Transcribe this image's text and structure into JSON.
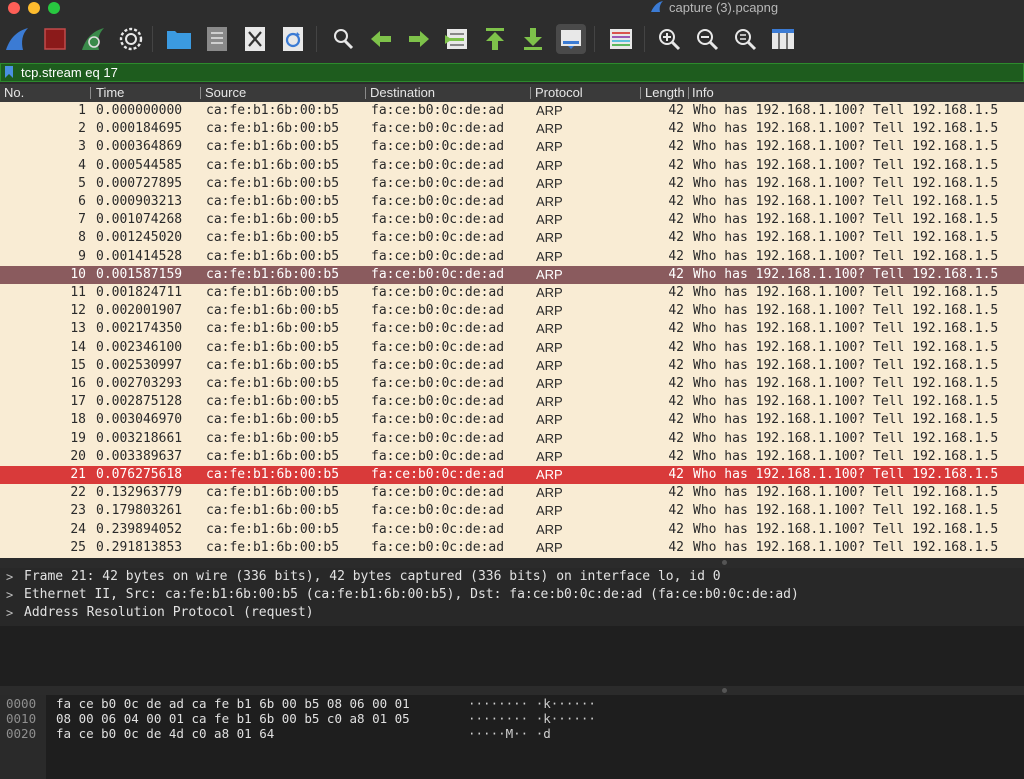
{
  "window": {
    "title": "capture (3).pcapng"
  },
  "toolbar": {
    "buttons": [
      {
        "name": "start-capture-icon"
      },
      {
        "name": "stop-capture-icon"
      },
      {
        "name": "restart-capture-icon"
      },
      {
        "name": "capture-options-icon"
      },
      {
        "name": "open-file-icon"
      },
      {
        "name": "save-file-icon"
      },
      {
        "name": "close-file-icon"
      },
      {
        "name": "reload-file-icon"
      },
      {
        "name": "find-packet-icon"
      },
      {
        "name": "go-back-icon"
      },
      {
        "name": "go-forward-icon"
      },
      {
        "name": "go-to-packet-icon"
      },
      {
        "name": "go-first-packet-icon"
      },
      {
        "name": "go-last-packet-icon"
      },
      {
        "name": "auto-scroll-icon"
      },
      {
        "name": "colorize-icon"
      },
      {
        "name": "zoom-in-icon"
      },
      {
        "name": "zoom-out-icon"
      },
      {
        "name": "zoom-normal-icon"
      },
      {
        "name": "resize-columns-icon"
      }
    ]
  },
  "filter": {
    "value": "tcp.stream eq 17"
  },
  "columns": {
    "no": "No.",
    "time": "Time",
    "source": "Source",
    "destination": "Destination",
    "protocol": "Protocol",
    "length": "Length",
    "info": "Info"
  },
  "packets": [
    {
      "no": "1",
      "time": "0.000000000",
      "source": "ca:fe:b1:6b:00:b5",
      "destination": "fa:ce:b0:0c:de:ad",
      "protocol": "ARP",
      "length": "42",
      "info": "Who has 192.168.1.100? Tell 192.168.1.5"
    },
    {
      "no": "2",
      "time": "0.000184695",
      "source": "ca:fe:b1:6b:00:b5",
      "destination": "fa:ce:b0:0c:de:ad",
      "protocol": "ARP",
      "length": "42",
      "info": "Who has 192.168.1.100? Tell 192.168.1.5"
    },
    {
      "no": "3",
      "time": "0.000364869",
      "source": "ca:fe:b1:6b:00:b5",
      "destination": "fa:ce:b0:0c:de:ad",
      "protocol": "ARP",
      "length": "42",
      "info": "Who has 192.168.1.100? Tell 192.168.1.5"
    },
    {
      "no": "4",
      "time": "0.000544585",
      "source": "ca:fe:b1:6b:00:b5",
      "destination": "fa:ce:b0:0c:de:ad",
      "protocol": "ARP",
      "length": "42",
      "info": "Who has 192.168.1.100? Tell 192.168.1.5"
    },
    {
      "no": "5",
      "time": "0.000727895",
      "source": "ca:fe:b1:6b:00:b5",
      "destination": "fa:ce:b0:0c:de:ad",
      "protocol": "ARP",
      "length": "42",
      "info": "Who has 192.168.1.100? Tell 192.168.1.5"
    },
    {
      "no": "6",
      "time": "0.000903213",
      "source": "ca:fe:b1:6b:00:b5",
      "destination": "fa:ce:b0:0c:de:ad",
      "protocol": "ARP",
      "length": "42",
      "info": "Who has 192.168.1.100? Tell 192.168.1.5"
    },
    {
      "no": "7",
      "time": "0.001074268",
      "source": "ca:fe:b1:6b:00:b5",
      "destination": "fa:ce:b0:0c:de:ad",
      "protocol": "ARP",
      "length": "42",
      "info": "Who has 192.168.1.100? Tell 192.168.1.5"
    },
    {
      "no": "8",
      "time": "0.001245020",
      "source": "ca:fe:b1:6b:00:b5",
      "destination": "fa:ce:b0:0c:de:ad",
      "protocol": "ARP",
      "length": "42",
      "info": "Who has 192.168.1.100? Tell 192.168.1.5"
    },
    {
      "no": "9",
      "time": "0.001414528",
      "source": "ca:fe:b1:6b:00:b5",
      "destination": "fa:ce:b0:0c:de:ad",
      "protocol": "ARP",
      "length": "42",
      "info": "Who has 192.168.1.100? Tell 192.168.1.5"
    },
    {
      "no": "10",
      "time": "0.001587159",
      "source": "ca:fe:b1:6b:00:b5",
      "destination": "fa:ce:b0:0c:de:ad",
      "protocol": "ARP",
      "length": "42",
      "info": "Who has 192.168.1.100? Tell 192.168.1.5"
    },
    {
      "no": "11",
      "time": "0.001824711",
      "source": "ca:fe:b1:6b:00:b5",
      "destination": "fa:ce:b0:0c:de:ad",
      "protocol": "ARP",
      "length": "42",
      "info": "Who has 192.168.1.100? Tell 192.168.1.5"
    },
    {
      "no": "12",
      "time": "0.002001907",
      "source": "ca:fe:b1:6b:00:b5",
      "destination": "fa:ce:b0:0c:de:ad",
      "protocol": "ARP",
      "length": "42",
      "info": "Who has 192.168.1.100? Tell 192.168.1.5"
    },
    {
      "no": "13",
      "time": "0.002174350",
      "source": "ca:fe:b1:6b:00:b5",
      "destination": "fa:ce:b0:0c:de:ad",
      "protocol": "ARP",
      "length": "42",
      "info": "Who has 192.168.1.100? Tell 192.168.1.5"
    },
    {
      "no": "14",
      "time": "0.002346100",
      "source": "ca:fe:b1:6b:00:b5",
      "destination": "fa:ce:b0:0c:de:ad",
      "protocol": "ARP",
      "length": "42",
      "info": "Who has 192.168.1.100? Tell 192.168.1.5"
    },
    {
      "no": "15",
      "time": "0.002530997",
      "source": "ca:fe:b1:6b:00:b5",
      "destination": "fa:ce:b0:0c:de:ad",
      "protocol": "ARP",
      "length": "42",
      "info": "Who has 192.168.1.100? Tell 192.168.1.5"
    },
    {
      "no": "16",
      "time": "0.002703293",
      "source": "ca:fe:b1:6b:00:b5",
      "destination": "fa:ce:b0:0c:de:ad",
      "protocol": "ARP",
      "length": "42",
      "info": "Who has 192.168.1.100? Tell 192.168.1.5"
    },
    {
      "no": "17",
      "time": "0.002875128",
      "source": "ca:fe:b1:6b:00:b5",
      "destination": "fa:ce:b0:0c:de:ad",
      "protocol": "ARP",
      "length": "42",
      "info": "Who has 192.168.1.100? Tell 192.168.1.5"
    },
    {
      "no": "18",
      "time": "0.003046970",
      "source": "ca:fe:b1:6b:00:b5",
      "destination": "fa:ce:b0:0c:de:ad",
      "protocol": "ARP",
      "length": "42",
      "info": "Who has 192.168.1.100? Tell 192.168.1.5"
    },
    {
      "no": "19",
      "time": "0.003218661",
      "source": "ca:fe:b1:6b:00:b5",
      "destination": "fa:ce:b0:0c:de:ad",
      "protocol": "ARP",
      "length": "42",
      "info": "Who has 192.168.1.100? Tell 192.168.1.5"
    },
    {
      "no": "20",
      "time": "0.003389637",
      "source": "ca:fe:b1:6b:00:b5",
      "destination": "fa:ce:b0:0c:de:ad",
      "protocol": "ARP",
      "length": "42",
      "info": "Who has 192.168.1.100? Tell 192.168.1.5"
    },
    {
      "no": "21",
      "time": "0.076275618",
      "source": "ca:fe:b1:6b:00:b5",
      "destination": "fa:ce:b0:0c:de:ad",
      "protocol": "ARP",
      "length": "42",
      "info": "Who has 192.168.1.100? Tell 192.168.1.5"
    },
    {
      "no": "22",
      "time": "0.132963779",
      "source": "ca:fe:b1:6b:00:b5",
      "destination": "fa:ce:b0:0c:de:ad",
      "protocol": "ARP",
      "length": "42",
      "info": "Who has 192.168.1.100? Tell 192.168.1.5"
    },
    {
      "no": "23",
      "time": "0.179803261",
      "source": "ca:fe:b1:6b:00:b5",
      "destination": "fa:ce:b0:0c:de:ad",
      "protocol": "ARP",
      "length": "42",
      "info": "Who has 192.168.1.100? Tell 192.168.1.5"
    },
    {
      "no": "24",
      "time": "0.239894052",
      "source": "ca:fe:b1:6b:00:b5",
      "destination": "fa:ce:b0:0c:de:ad",
      "protocol": "ARP",
      "length": "42",
      "info": "Who has 192.168.1.100? Tell 192.168.1.5"
    },
    {
      "no": "25",
      "time": "0.291813853",
      "source": "ca:fe:b1:6b:00:b5",
      "destination": "fa:ce:b0:0c:de:ad",
      "protocol": "ARP",
      "length": "42",
      "info": "Who has 192.168.1.100? Tell 192.168.1.5"
    }
  ],
  "details": [
    {
      "text": "Frame 21: 42 bytes on wire (336 bits), 42 bytes captured (336 bits) on interface lo, id 0"
    },
    {
      "text": "Ethernet II, Src: ca:fe:b1:6b:00:b5 (ca:fe:b1:6b:00:b5), Dst: fa:ce:b0:0c:de:ad (fa:ce:b0:0c:de:ad)"
    },
    {
      "text": "Address Resolution Protocol (request)"
    }
  ],
  "bytes": [
    {
      "offset": "0000",
      "hex": "fa ce b0 0c de ad ca fe  b1 6b 00 b5 08 06 00 01",
      "ascii": "········ ·k······"
    },
    {
      "offset": "0010",
      "hex": "08 00 06 04 00 01 ca fe  b1 6b 00 b5 c0 a8 01 05",
      "ascii": "········ ·k······"
    },
    {
      "offset": "0020",
      "hex": "fa ce b0 0c de 4d c0 a8  01 64",
      "ascii": "·····M·· ·d"
    }
  ],
  "colors": {
    "row_bg": "#f9ecd4",
    "selected_row": "#8a5b5e",
    "marked_row": "#d93a3a",
    "filter_valid": "#1e5c1e"
  }
}
